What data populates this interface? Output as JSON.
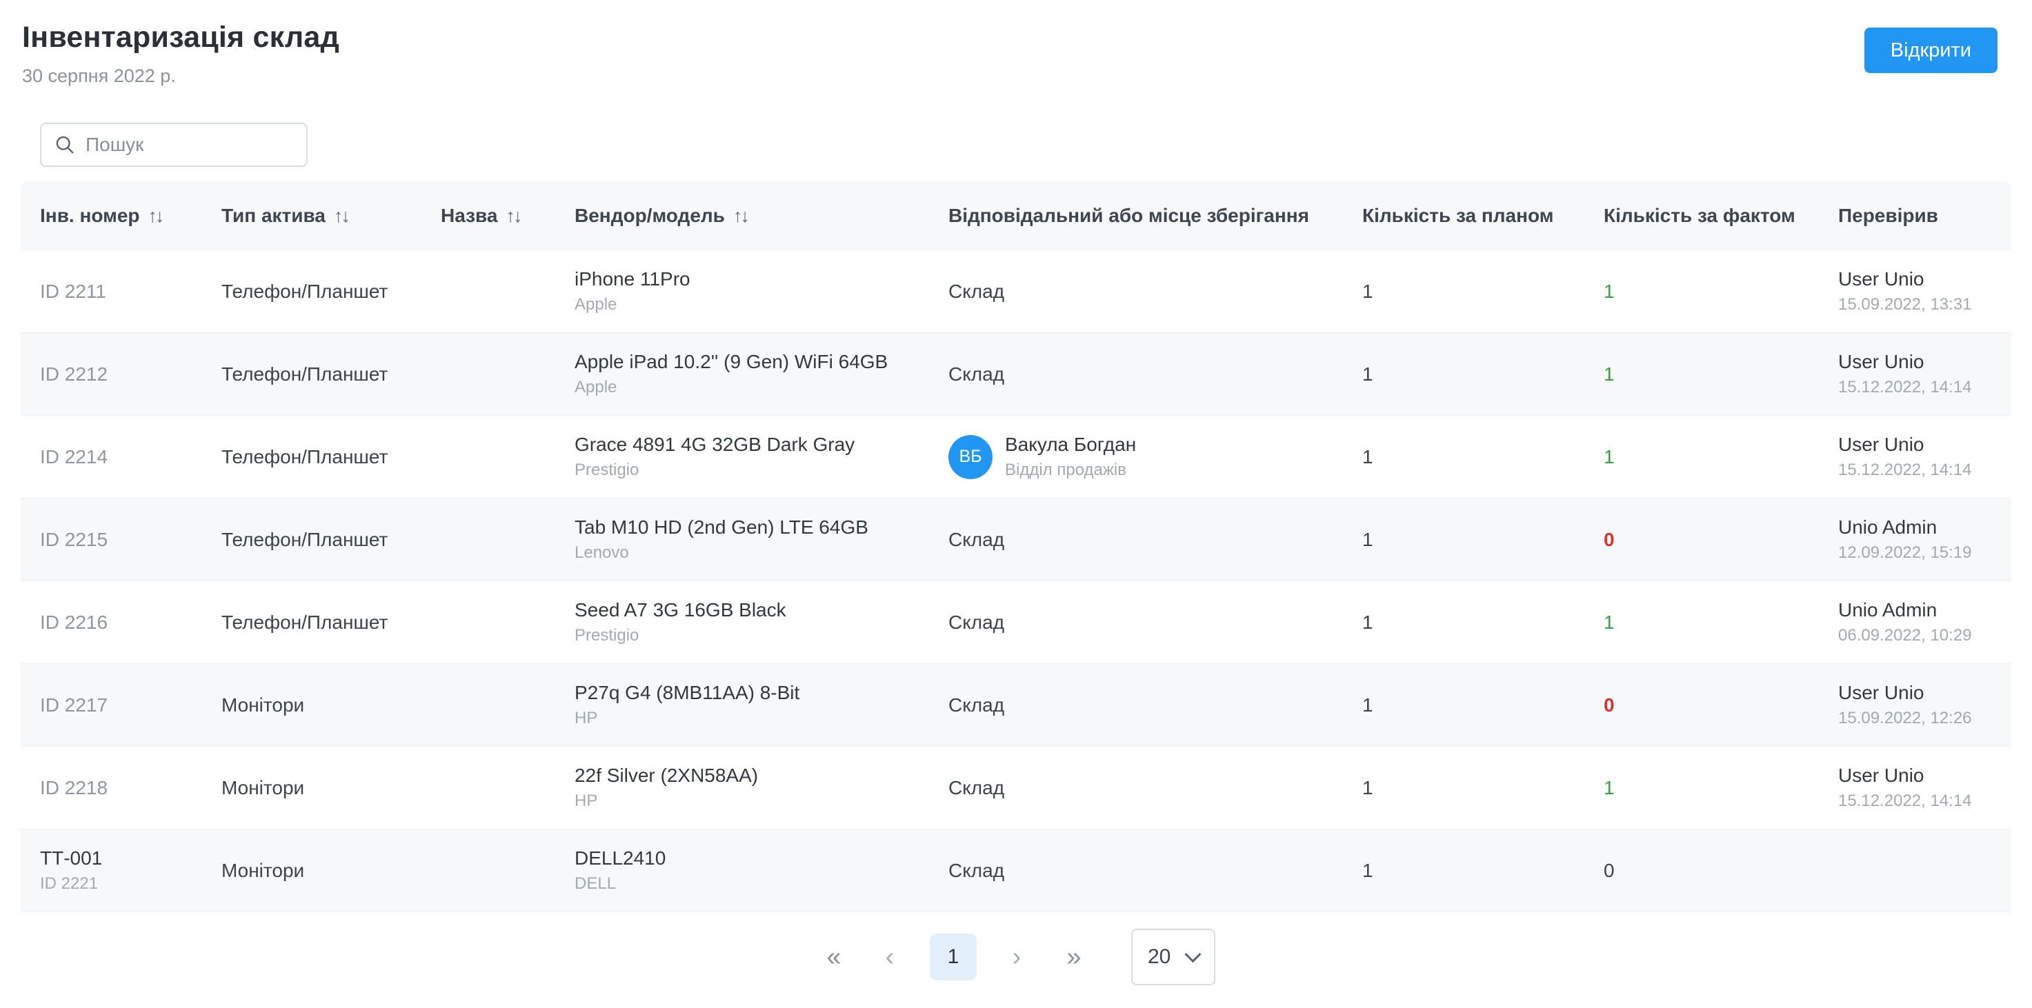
{
  "colors": {
    "accent": "#2196f3",
    "success": "#389e44",
    "danger": "#d6352b",
    "active_page_bg": "#e3f0fb"
  },
  "header": {
    "title": "Інвентаризація склад",
    "date": "30 серпня 2022 р.",
    "open_button_label": "Відкрити"
  },
  "search": {
    "placeholder": "Пошук"
  },
  "table": {
    "sort_icon": "↑↓",
    "columns": [
      {
        "label": "Інв. номер",
        "sortable": true
      },
      {
        "label": "Тип актива",
        "sortable": true
      },
      {
        "label": "Назва",
        "sortable": true
      },
      {
        "label": "Вендор/модель",
        "sortable": true
      },
      {
        "label": "Відповідальний або місце зберігання",
        "sortable": false
      },
      {
        "label": "Кількість за планом",
        "sortable": false
      },
      {
        "label": "Кількість за фактом",
        "sortable": false
      },
      {
        "label": "Перевірив",
        "sortable": false
      }
    ],
    "rows": [
      {
        "inv_primary": "ID 2211",
        "inv_secondary": "",
        "inv_muted": true,
        "type": "Телефон/Планшет",
        "name": "",
        "model": "iPhone 11Pro",
        "vendor": "Apple",
        "responsible": {
          "kind": "place",
          "name": "Склад",
          "dept": "",
          "initials": ""
        },
        "plan": "1",
        "fact": "1",
        "fact_status": "ok",
        "checked_by": "User Unio",
        "checked_at": "15.09.2022, 13:31"
      },
      {
        "inv_primary": "ID 2212",
        "inv_secondary": "",
        "inv_muted": true,
        "type": "Телефон/Планшет",
        "name": "",
        "model": "Apple iPad 10.2'' (9 Gen) WiFi 64GB",
        "vendor": "Apple",
        "responsible": {
          "kind": "place",
          "name": "Склад",
          "dept": "",
          "initials": ""
        },
        "plan": "1",
        "fact": "1",
        "fact_status": "ok",
        "checked_by": "User Unio",
        "checked_at": "15.12.2022, 14:14"
      },
      {
        "inv_primary": "ID 2214",
        "inv_secondary": "",
        "inv_muted": true,
        "type": "Телефон/Планшет",
        "name": "",
        "model": "Grace 4891 4G 32GB Dark Gray",
        "vendor": "Prestigio",
        "responsible": {
          "kind": "person",
          "name": "Вакула Богдан",
          "dept": "Відділ продажів",
          "initials": "ВБ"
        },
        "plan": "1",
        "fact": "1",
        "fact_status": "ok",
        "checked_by": "User Unio",
        "checked_at": "15.12.2022, 14:14"
      },
      {
        "inv_primary": "ID 2215",
        "inv_secondary": "",
        "inv_muted": true,
        "type": "Телефон/Планшет",
        "name": "",
        "model": "Tab M10 HD (2nd Gen) LTE 64GB",
        "vendor": "Lenovo",
        "responsible": {
          "kind": "place",
          "name": "Склад",
          "dept": "",
          "initials": ""
        },
        "plan": "1",
        "fact": "0",
        "fact_status": "bad",
        "checked_by": "Unio Admin",
        "checked_at": "12.09.2022, 15:19"
      },
      {
        "inv_primary": "ID 2216",
        "inv_secondary": "",
        "inv_muted": true,
        "type": "Телефон/Планшет",
        "name": "",
        "model": "Seed A7 3G 16GB Black",
        "vendor": "Prestigio",
        "responsible": {
          "kind": "place",
          "name": "Склад",
          "dept": "",
          "initials": ""
        },
        "plan": "1",
        "fact": "1",
        "fact_status": "ok",
        "checked_by": "Unio Admin",
        "checked_at": "06.09.2022, 10:29"
      },
      {
        "inv_primary": "ID 2217",
        "inv_secondary": "",
        "inv_muted": true,
        "type": "Монітори",
        "name": "",
        "model": "P27q G4 (8MB11AA) 8-Bit",
        "vendor": "HP",
        "responsible": {
          "kind": "place",
          "name": "Склад",
          "dept": "",
          "initials": ""
        },
        "plan": "1",
        "fact": "0",
        "fact_status": "bad",
        "checked_by": "User Unio",
        "checked_at": "15.09.2022, 12:26"
      },
      {
        "inv_primary": "ID 2218",
        "inv_secondary": "",
        "inv_muted": true,
        "type": "Монітори",
        "name": "",
        "model": "22f Silver (2XN58AA)",
        "vendor": "HP",
        "responsible": {
          "kind": "place",
          "name": "Склад",
          "dept": "",
          "initials": ""
        },
        "plan": "1",
        "fact": "1",
        "fact_status": "ok",
        "checked_by": "User Unio",
        "checked_at": "15.12.2022, 14:14"
      },
      {
        "inv_primary": "ТТ-001",
        "inv_secondary": "ID 2221",
        "inv_muted": false,
        "type": "Монітори",
        "name": "",
        "model": "DELL2410",
        "vendor": "DELL",
        "responsible": {
          "kind": "place",
          "name": "Склад",
          "dept": "",
          "initials": ""
        },
        "plan": "1",
        "fact": "0",
        "fact_status": "neutral",
        "checked_by": "",
        "checked_at": ""
      }
    ]
  },
  "pagination": {
    "first_icon": "«",
    "prev_icon": "‹",
    "current_page": "1",
    "next_icon": "›",
    "last_icon": "»",
    "page_size": "20"
  }
}
